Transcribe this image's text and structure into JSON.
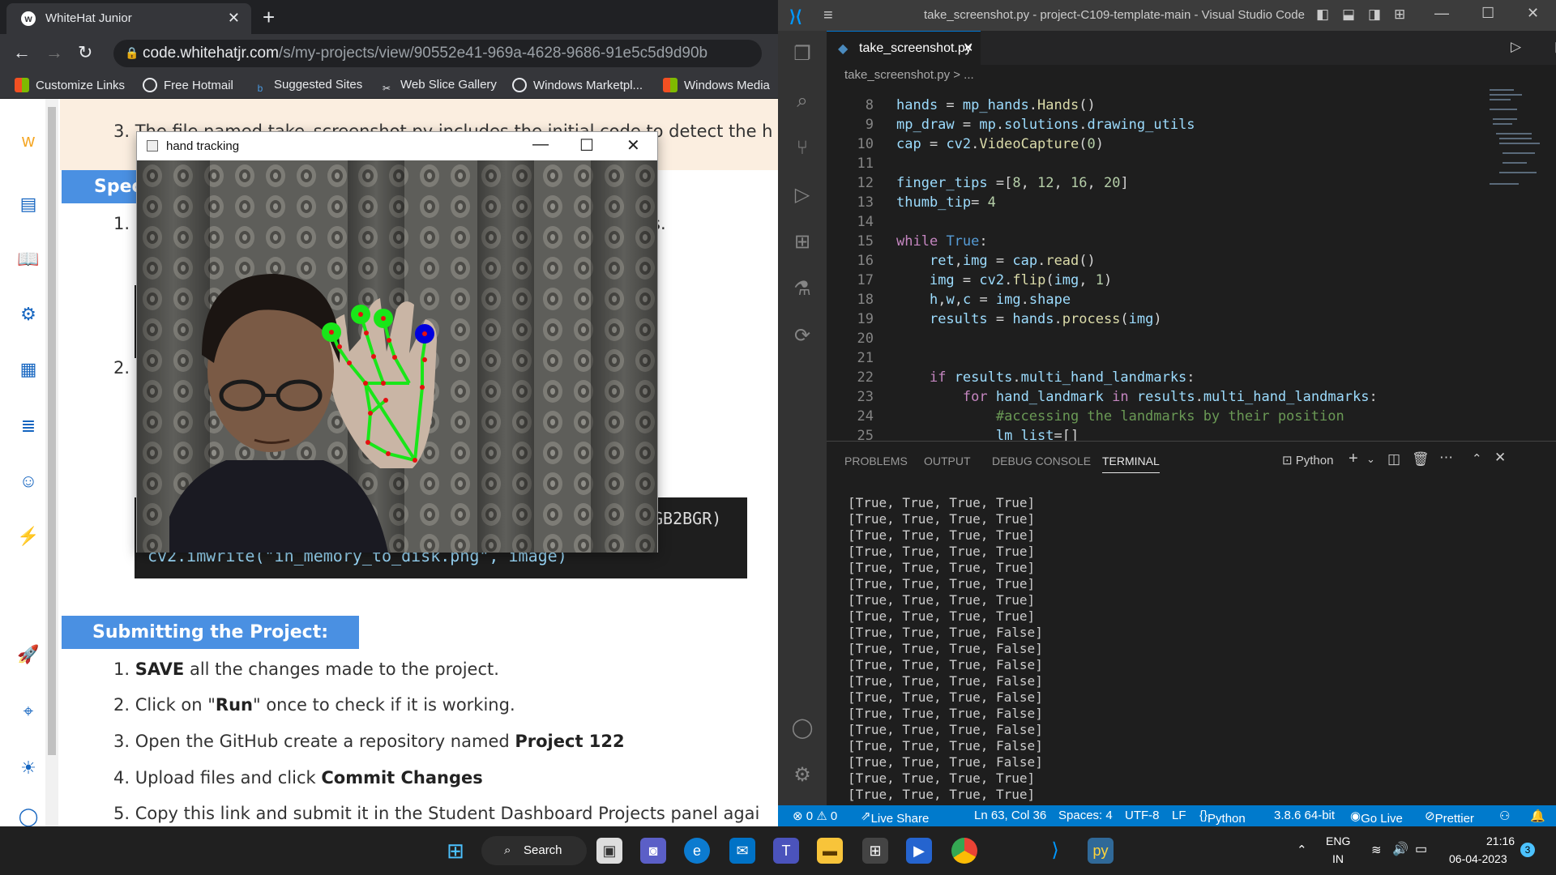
{
  "browser": {
    "tab_title": "WhiteHat Junior",
    "tab_close": "✕",
    "new_tab": "+",
    "url_host": "code.whitehatjr.com",
    "url_path": "/s/my-projects/view/90552e41-969a-4628-9686-91e5c5d9d90b",
    "bookmarks": [
      "Customize Links",
      "Free Hotmail",
      "Suggested Sites",
      "Web Slice Gallery",
      "Windows Marketpl...",
      "Windows Media"
    ]
  },
  "page": {
    "item3_partial": "3. The file named take_screenshot.py includes the initial code to detect the h",
    "spec_header": "Spec",
    "item1_prefix": "1.",
    "item1_tail": "s.",
    "item2_prefix": "2.",
    "code_tail": "GB2BGR)",
    "code_line": "cv2.imwrite(\"in_memory_to_disk.png\", image)",
    "submit_header": "Submitting the Project:",
    "steps": [
      {
        "pre": "1. ",
        "b": "SAVE",
        "post": " all the changes made to the project."
      },
      {
        "pre": "2. Click on \"",
        "b": "Run",
        "post": "\" once to check if it is working."
      },
      {
        "pre": "3. Open the GitHub create a repository named ",
        "b": "Project 122",
        "post": ""
      },
      {
        "pre": "4. Upload files and click ",
        "b": "Commit Changes",
        "post": ""
      },
      {
        "pre": "5. Copy this link and submit it in the Student Dashboard Projects panel agai",
        "b": "",
        "post": ""
      }
    ]
  },
  "hand_window": {
    "title": "hand tracking",
    "min": "—",
    "max": "☐",
    "close": "✕"
  },
  "vscode": {
    "title": "take_screenshot.py - project-C109-template-main - Visual Studio Code",
    "tab": "take_screenshot.py",
    "breadcrumb": "take_screenshot.py > ...",
    "panel_tabs": [
      "PROBLEMS",
      "OUTPUT",
      "DEBUG CONSOLE",
      "TERMINAL"
    ],
    "terminal_shell": "Python",
    "terminal_lines": [
      "[True, True, True, True]",
      "[True, True, True, True]",
      "[True, True, True, True]",
      "[True, True, True, True]",
      "[True, True, True, True]",
      "[True, True, True, True]",
      "[True, True, True, True]",
      "[True, True, True, True]",
      "[True, True, True, False]",
      "[True, True, True, False]",
      "[True, True, True, False]",
      "[True, True, True, False]",
      "[True, True, True, False]",
      "[True, True, True, False]",
      "[True, True, True, False]",
      "[True, True, True, False]",
      "[True, True, True, False]",
      "[True, True, True, True]",
      "[True, True, True, True]"
    ],
    "status": {
      "errors": "⊗ 0 ⚠ 0",
      "liveshare": "Live Share",
      "position": "Ln 63, Col 36",
      "spaces": "Spaces: 4",
      "encoding": "UTF-8",
      "eol": "LF",
      "language": "Python",
      "interpreter": "3.8.6 64-bit",
      "golive": "Go Live",
      "prettier": "Prettier"
    }
  },
  "taskbar": {
    "search": "Search",
    "lang1": "ENG",
    "lang2": "IN",
    "time": "21:16",
    "date": "06-04-2023",
    "badge": "3"
  }
}
